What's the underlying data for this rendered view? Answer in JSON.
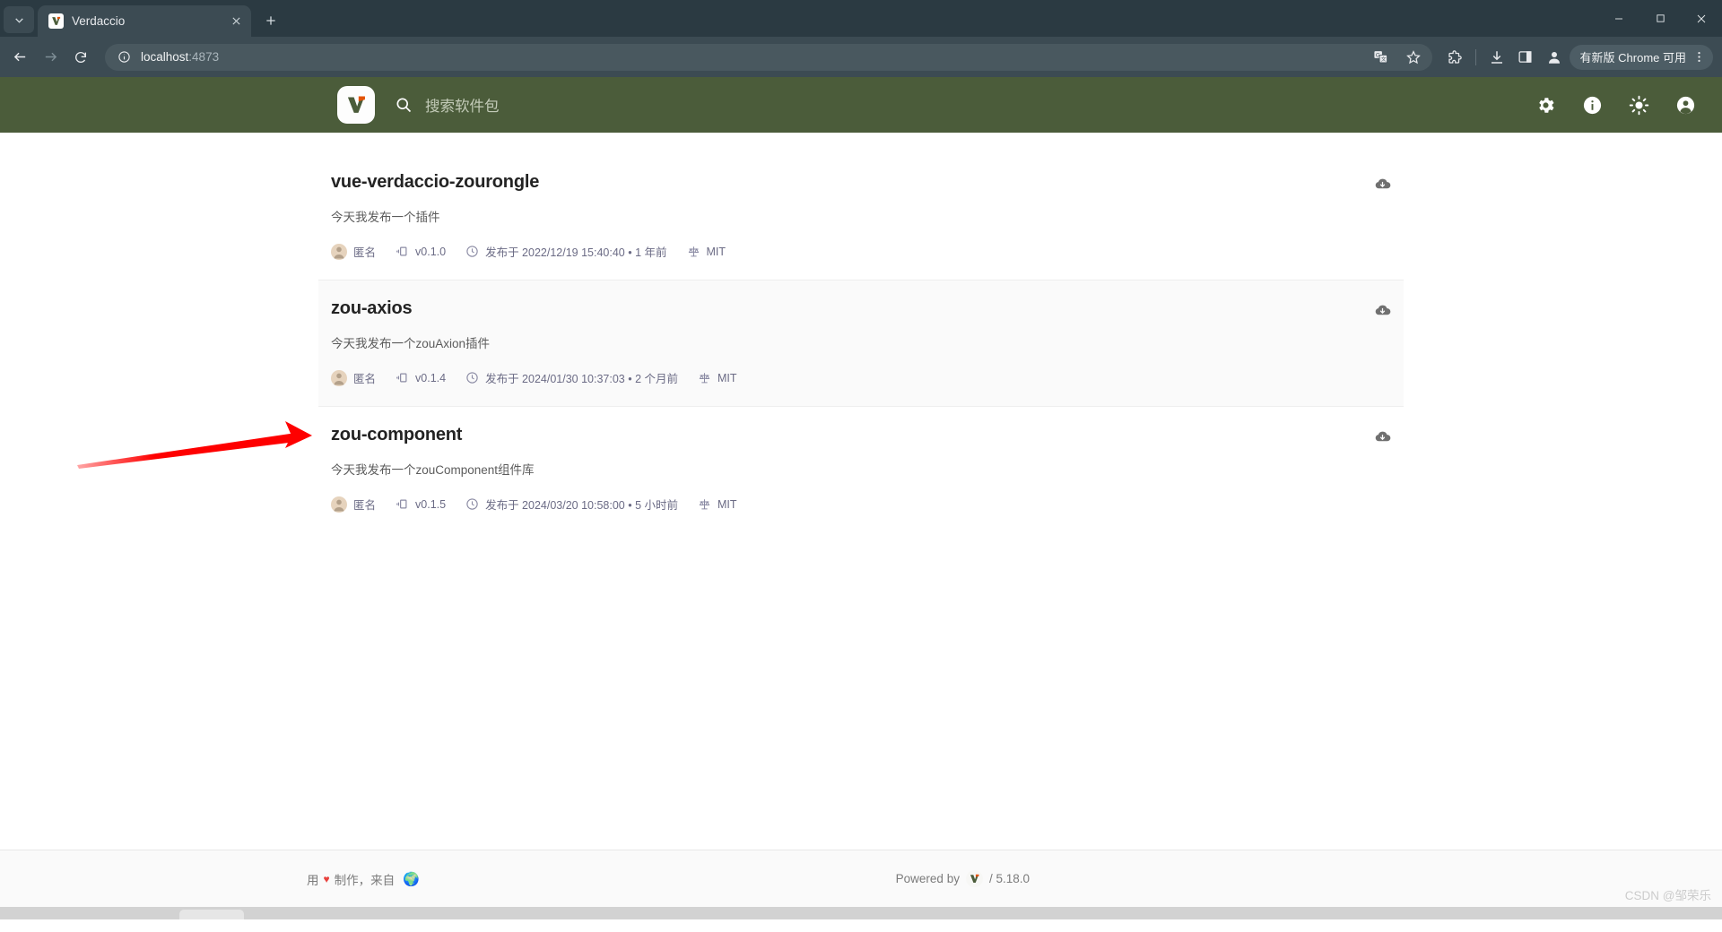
{
  "browser": {
    "tab": {
      "title": "Verdaccio",
      "favicon": "verdaccio-logo-icon",
      "close_icon": "close-icon"
    },
    "new_tab_icon": "plus-icon",
    "tab_search_icon": "chevron-down-icon",
    "window_controls": {
      "minimize": "minimize-icon",
      "maximize": "maximize-icon",
      "close": "close-icon"
    },
    "nav": {
      "back": "back-arrow-icon",
      "forward": "forward-arrow-icon",
      "reload": "reload-icon"
    },
    "omnibox": {
      "site_info_icon": "info-circle-icon",
      "url_host": "localhost",
      "url_port": ":4873",
      "translate_icon": "translate-icon",
      "bookmark_icon": "star-icon"
    },
    "toolbar_icons": {
      "extensions": "puzzle-piece-icon",
      "downloads": "download-icon",
      "side_panel": "side-panel-icon",
      "profile": "account-circle-icon",
      "menu": "three-dots-menu-icon"
    },
    "update_pill": {
      "label": "有新版 Chrome 可用"
    }
  },
  "app": {
    "header": {
      "logo": "verdaccio-logo-icon",
      "search_icon": "search-icon",
      "search_placeholder": "搜索软件包",
      "search_value": "",
      "icons": [
        {
          "name": "settings-icon",
          "glyph": "gear"
        },
        {
          "name": "information-icon",
          "glyph": "info"
        },
        {
          "name": "light-mode-icon",
          "glyph": "sun"
        },
        {
          "name": "account-icon",
          "glyph": "account"
        }
      ]
    },
    "packages": [
      {
        "name": "vue-verdaccio-zourongle",
        "description": "今天我发布一个插件",
        "author": "匿名",
        "version": "v0.1.0",
        "published": "发布于 2022/12/19 15:40:40 • 1 年前",
        "license": "MIT",
        "download_icon": "cloud-download-icon",
        "hovered": false
      },
      {
        "name": "zou-axios",
        "description": "今天我发布一个zouAxion插件",
        "author": "匿名",
        "version": "v0.1.4",
        "published": "发布于 2024/01/30 10:37:03 • 2 个月前",
        "license": "MIT",
        "download_icon": "cloud-download-icon",
        "hovered": true
      },
      {
        "name": "zou-component",
        "description": "今天我发布一个zouComponent组件库",
        "author": "匿名",
        "version": "v0.1.5",
        "published": "发布于 2024/03/20 10:58:00 • 5 小时前",
        "license": "MIT",
        "download_icon": "cloud-download-icon",
        "hovered": false
      }
    ],
    "footer": {
      "made_prefix": "用",
      "heart": "♥",
      "made_middle": "制作，来自",
      "globe": "🌍",
      "powered_by": "Powered by",
      "version": "/ 5.18.0"
    }
  },
  "overlay": {
    "watermark": "CSDN @邹荣乐",
    "arrow_color": "#fe0000"
  },
  "colors": {
    "app_header_bg": "#4b5c3a",
    "browser_chrome_bg": "#3c4b53",
    "tabstrip_bg": "#2b3a42",
    "page_bg": "#ffffff",
    "row_hover_bg": "#fafafa",
    "footer_bg": "#fafafa",
    "heart_red": "#e8413c"
  }
}
